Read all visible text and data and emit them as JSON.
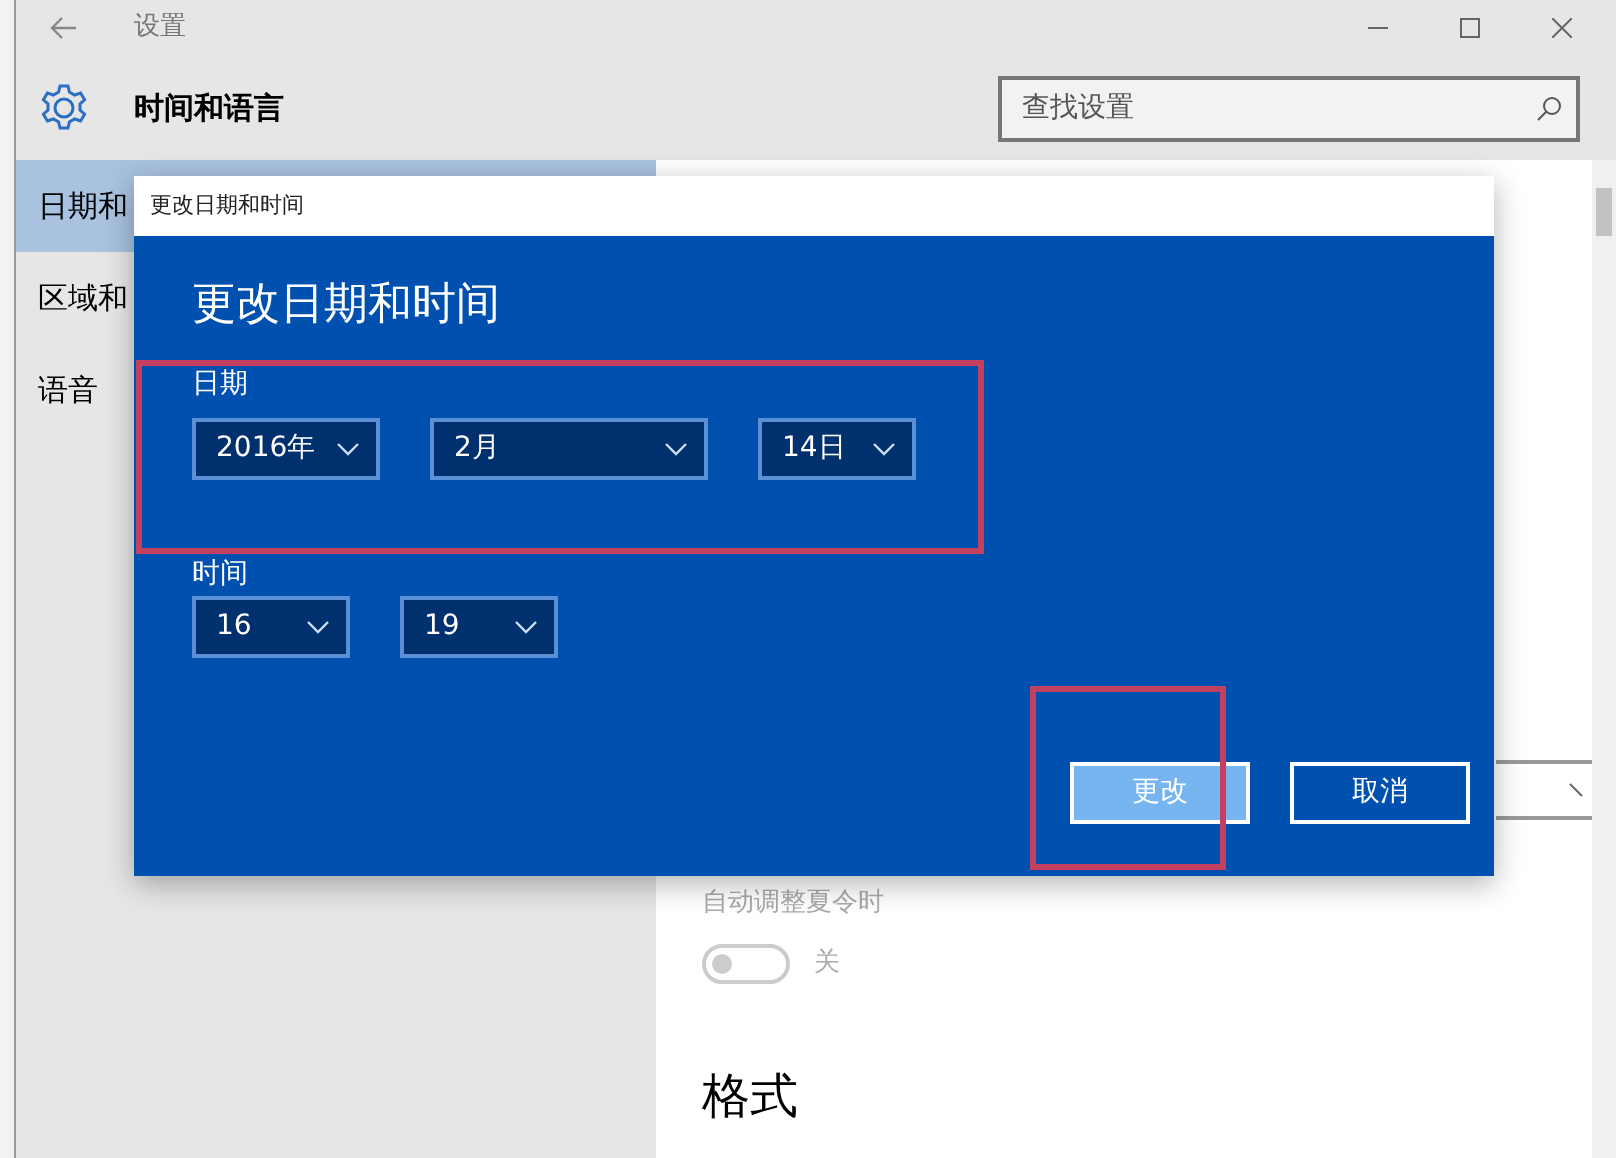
{
  "window": {
    "title": "设置"
  },
  "header": {
    "title": "时间和语言",
    "search": {
      "placeholder": "查找设置"
    }
  },
  "sidebar": {
    "items": [
      {
        "label": "日期和",
        "selected": true
      },
      {
        "label": "区域和",
        "selected": false
      },
      {
        "label": "语音",
        "selected": false
      }
    ]
  },
  "content": {
    "daylight_saving": {
      "label": "自动调整夏令时",
      "on": false,
      "state_text": "关",
      "disabled": true
    },
    "section_heading": "格式"
  },
  "dialog": {
    "title": "更改日期和时间",
    "heading": "更改日期和时间",
    "date": {
      "label": "日期",
      "fields": [
        "2016年",
        "2月",
        "14日"
      ]
    },
    "time": {
      "label": "时间",
      "fields": [
        "16",
        "19"
      ]
    },
    "buttons": [
      {
        "label": "更改",
        "kind": "primary"
      },
      {
        "label": "取消",
        "kind": "secondary"
      }
    ]
  }
}
